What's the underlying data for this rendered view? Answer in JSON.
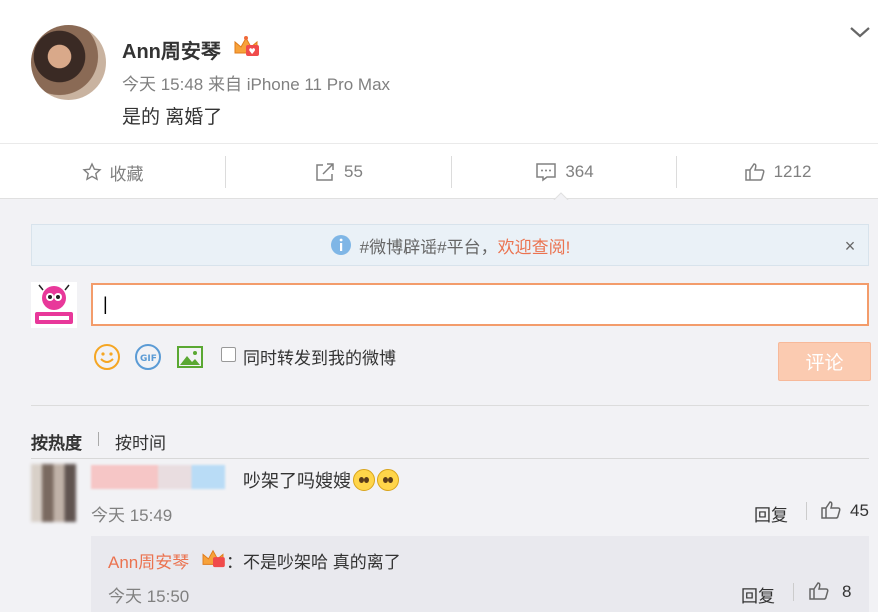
{
  "post": {
    "author": "Ann周安琴",
    "meta": "今天 15:48 来自 iPhone 11 Pro Max",
    "text": "是的 离婚了"
  },
  "actions": {
    "favorite_label": "收藏",
    "repost_count": "55",
    "comment_count": "364",
    "like_count": "1212"
  },
  "notice": {
    "text": "#微博辟谣#平台，",
    "link_text": "欢迎查阅!",
    "close_glyph": "×"
  },
  "compose": {
    "sync_label": "同时转发到我的微博",
    "submit_label": "评论"
  },
  "sort": {
    "hot": "按热度",
    "time": "按时间"
  },
  "comments": [
    {
      "text": "吵架了吗嫂嫂",
      "time": "今天 15:49",
      "reply_label": "回复",
      "likes": "45",
      "replies": [
        {
          "author": "Ann周安琴",
          "text": "：不是吵架哈 真的离了",
          "time": "今天 15:50",
          "reply_label": "回复",
          "likes": "8"
        }
      ]
    }
  ],
  "colors": {
    "accent": "#eb7350",
    "submit_disabled": "#fbcbb1",
    "input_border": "#f39c6b",
    "notice_bg": "#eaf1f7"
  }
}
